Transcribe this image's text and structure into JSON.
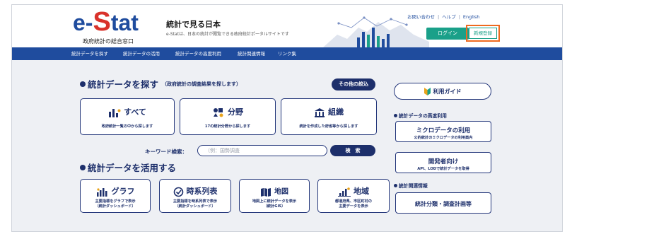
{
  "brand": {
    "logo_prefix": "e-",
    "logo_s": "S",
    "logo_suffix": "tat",
    "logo_subtitle": "政府統計の総合窓口",
    "site_title": "統計で見る日本",
    "site_description": "e-Statは、日本の統計が閲覧できる政府統計ポータルサイトです",
    "colors": {
      "primary": "#1f4c9e",
      "accent": "#d9322b",
      "teal": "#1aa089",
      "highlight": "#ee6a1f",
      "navy": "#1d2f6b"
    }
  },
  "utility": {
    "contact": "お問い合わせ",
    "separator": "|",
    "help": "ヘルプ",
    "language": "English"
  },
  "auth": {
    "login": "ログイン",
    "register": "新規登録"
  },
  "nav": {
    "items": [
      "統計データを探す",
      "統計データの活用",
      "統計データの高度利用",
      "統計関連情報",
      "リンク集"
    ]
  },
  "search_section": {
    "title": "統計データを探す",
    "note": "（政府統計の調査結果を探します）",
    "narrow_button": "その他の絞込",
    "cards": [
      {
        "title": "すべて",
        "desc": "政府統計一覧の中から探します",
        "icon": "bar-chart-icon"
      },
      {
        "title": "分野",
        "desc": "17の統計分野から探します",
        "icon": "category-icon"
      },
      {
        "title": "組織",
        "desc": "統計を作成した府省等から探します",
        "icon": "building-icon"
      }
    ],
    "keyword_label": "キーワード検索：",
    "keyword_placeholder": "（例：国勢調査",
    "search_button": "検　索"
  },
  "use_section": {
    "title": "統計データを活用する",
    "cards": [
      {
        "title": "グラフ",
        "desc1": "主要指標をグラフで表示",
        "desc2": "（統計ダッシュボード）",
        "icon": "graph-icon"
      },
      {
        "title": "時系列表",
        "desc1": "主要指標を時系列表で表示",
        "desc2": "（統計ダッシュボード）",
        "icon": "clock-check-icon"
      },
      {
        "title": "地図",
        "desc1": "地図上に統計データを表示",
        "desc2": "（統計GIS）",
        "icon": "map-book-icon"
      },
      {
        "title": "地域",
        "desc1": "都道府県、市区町村の",
        "desc2": "主要データを表示",
        "icon": "region-icon"
      }
    ]
  },
  "right_column": {
    "guide": "利用ガイド",
    "advanced_heading": "統計データの高度利用",
    "micro_title": "ミクロデータの利用",
    "micro_desc": "公的統計のミクロデータの利用案内",
    "dev_title": "開発者向け",
    "dev_desc": "API、LODで統計データを取得",
    "related_heading": "統計関連情報",
    "classification": "統計分類・調査計画等"
  }
}
